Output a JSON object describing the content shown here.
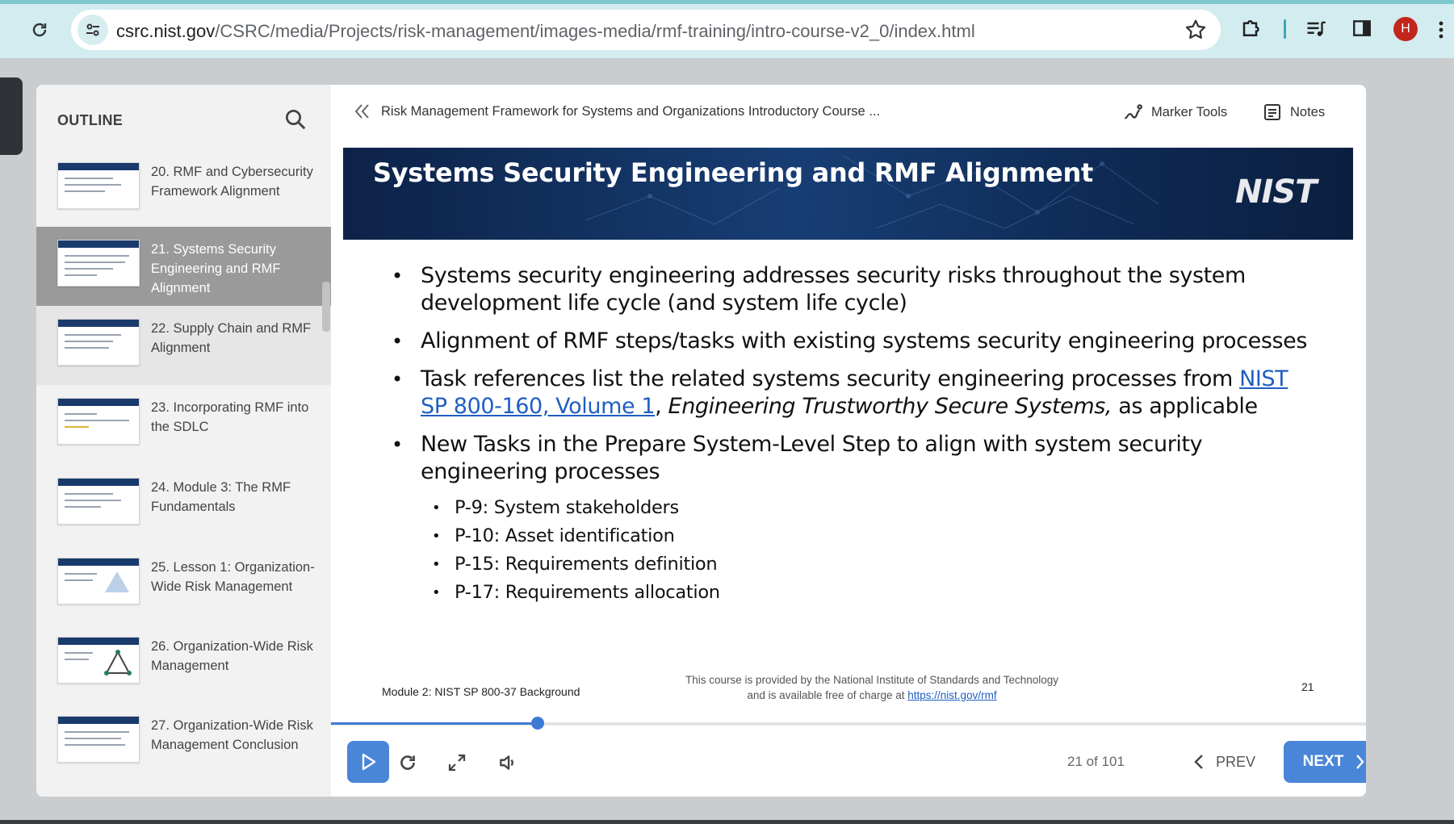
{
  "browser": {
    "url_host": "csrc.nist.gov",
    "url_path": "/CSRC/media/Projects/risk-management/images-media/rmf-training/intro-course-v2_0/index.html",
    "avatar_letter": "H"
  },
  "outline": {
    "heading": "OUTLINE",
    "items": [
      {
        "label": "20. RMF and Cybersecurity Framework Alignment"
      },
      {
        "label": "21. Systems Security Engineering and RMF Alignment"
      },
      {
        "label": "22. Supply Chain and RMF Alignment"
      },
      {
        "label": "23. Incorporating RMF into the SDLC"
      },
      {
        "label": "24. Module 3: The RMF Fundamentals"
      },
      {
        "label": "25. Lesson 1: Organization-Wide Risk Management"
      },
      {
        "label": "26. Organization-Wide Risk Management"
      },
      {
        "label": "27. Organization-Wide Risk Management Conclusion"
      }
    ]
  },
  "topbar": {
    "course_title": "Risk Management Framework for Systems and Organizations Introductory Course ...",
    "marker_tools": "Marker Tools",
    "notes": "Notes"
  },
  "slide": {
    "title": "Systems Security Engineering and RMF Alignment",
    "logo": "NIST",
    "bullet1": "Systems security engineering addresses security risks throughout the system development life cycle (and system life cycle)",
    "bullet2": "Alignment of RMF steps/tasks with existing systems security engineering processes",
    "bullet3_pre": "Task  references list the related systems security engineering processes from ",
    "bullet3_link": "NIST SP 800-160, Volume 1",
    "bullet3_sep": ", ",
    "bullet3_italic": "Engineering Trustworthy Secure Systems,",
    "bullet3_post": " as applicable",
    "bullet4": "New Tasks in the Prepare System-Level Step to align with system security engineering processes",
    "sub_items": [
      {
        "label": "P-9: System stakeholders"
      },
      {
        "label": "P-10: Asset identification"
      },
      {
        "label": "P-15: Requirements definition"
      },
      {
        "label": "P-17: Requirements allocation"
      }
    ],
    "footer_left": "Module 2: NIST SP 800-37 Background",
    "footer_mid_text": "This course is provided by the National Institute of Standards and Technology and is available free of charge at ",
    "footer_mid_link": "https://nist.gov/rmf",
    "number": "21"
  },
  "playback": {
    "progress": 0.2,
    "page_count": "21 of 101",
    "prev_label": "PREV",
    "next_label": "NEXT"
  },
  "colors": {
    "accent": "#4a86d8",
    "banner": "#173e74",
    "chrome": "#d3ecef"
  }
}
